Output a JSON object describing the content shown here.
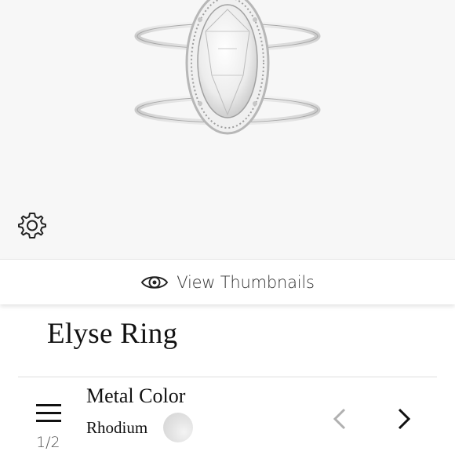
{
  "product": {
    "title": "Elyse Ring",
    "image_icon": "ring-image"
  },
  "toolbar": {
    "settings_icon": "gear-icon",
    "thumbnails_icon": "eye-icon",
    "thumbnails_label": "View Thumbnails"
  },
  "option": {
    "name": "Metal Color",
    "value": "Rhodium",
    "swatch_color": "#dcdcdc",
    "page": "1/2",
    "menu_icon": "hamburger-menu-icon",
    "prev_icon": "chevron-left-icon",
    "next_icon": "chevron-right-icon"
  },
  "colors": {
    "background": "#f7f7f7",
    "text": "#111111",
    "disabled": "#b0b0b0"
  }
}
